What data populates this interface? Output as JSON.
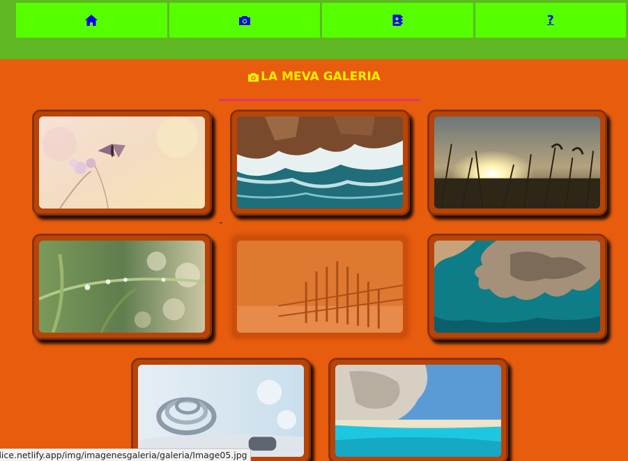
{
  "nav": {
    "items": [
      {
        "icon": "home-icon"
      },
      {
        "icon": "camera-icon"
      },
      {
        "icon": "contact-book-icon"
      },
      {
        "icon": "help-link",
        "label": "?"
      }
    ]
  },
  "gallery": {
    "title": "LA MEVA GALERIA",
    "title_icon": "camera-icon",
    "title_color": "#ffee00",
    "underline_color": "#e5336e",
    "images": [
      {
        "subject": "butterfly-on-flower"
      },
      {
        "subject": "ocean-waves-on-rocks"
      },
      {
        "subject": "sunset-grass"
      },
      {
        "subject": "dew-drops-on-grass"
      },
      {
        "subject": "wooden-fence-beach"
      },
      {
        "subject": "aerial-island-coast"
      },
      {
        "subject": "boat-rope-knot"
      },
      {
        "subject": "beach-cliff-turquoise-water"
      }
    ]
  },
  "colors": {
    "page_background": "#e85c0d",
    "header_background": "#5fb823",
    "nav_background": "#55ff00",
    "nav_icon_color": "#0000ee"
  },
  "statusbar": {
    "url": "dice.netlify.app/img/imagenesgaleria/galeria/Image05.jpg"
  }
}
